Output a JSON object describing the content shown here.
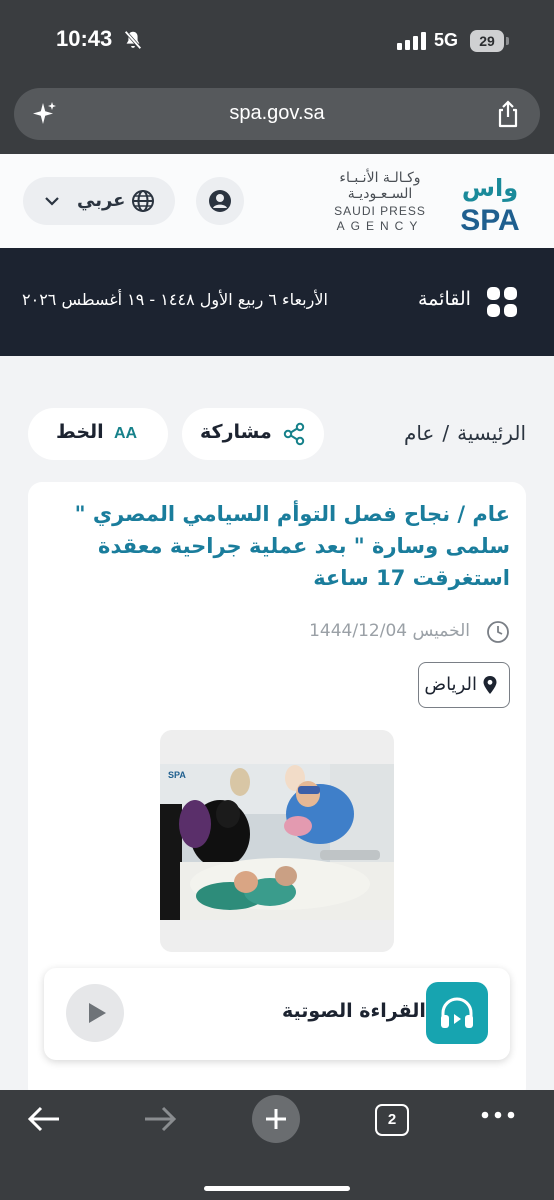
{
  "status_bar": {
    "time": "10:43",
    "network": "5G",
    "battery": "29"
  },
  "browser": {
    "url": "spa.gov.sa",
    "tab_count": "2"
  },
  "site_header": {
    "language_label": "عربي",
    "logo_arabic": "وكـالـة الأنـبـاء السـعـوديـة",
    "logo_english_line1": "SAUDI PRESS",
    "logo_english_line2": "AGENCY",
    "logo_mark_top": "واس",
    "logo_mark_bottom": "SPA"
  },
  "nav": {
    "date": "الأربعاء ٦ ربيع الأول ١٤٤٨ - ١٩ أغسطس ٢٠٢٦",
    "menu_label": "القائمة"
  },
  "toolbar": {
    "breadcrumb": [
      "الرئيسية",
      "عام"
    ],
    "breadcrumb_separator": "/",
    "share_label": "مشاركة",
    "font_label": "الخط",
    "font_icon_text": "AA"
  },
  "article": {
    "title": "عام / نجاح فصل التوأم السيامي المصري \" سلمى وسارة \" بعد عملية جراحية معقدة استغرقت 17 ساعة",
    "date": "الخميس 1444/12/04",
    "location": "الرياض",
    "audio_label": "القراءة الصوتية"
  },
  "colors": {
    "chrome": "#3a3d40",
    "nav_dark": "#1c2330",
    "title_blue": "#1a7d9c",
    "teal": "#17a4b0"
  }
}
